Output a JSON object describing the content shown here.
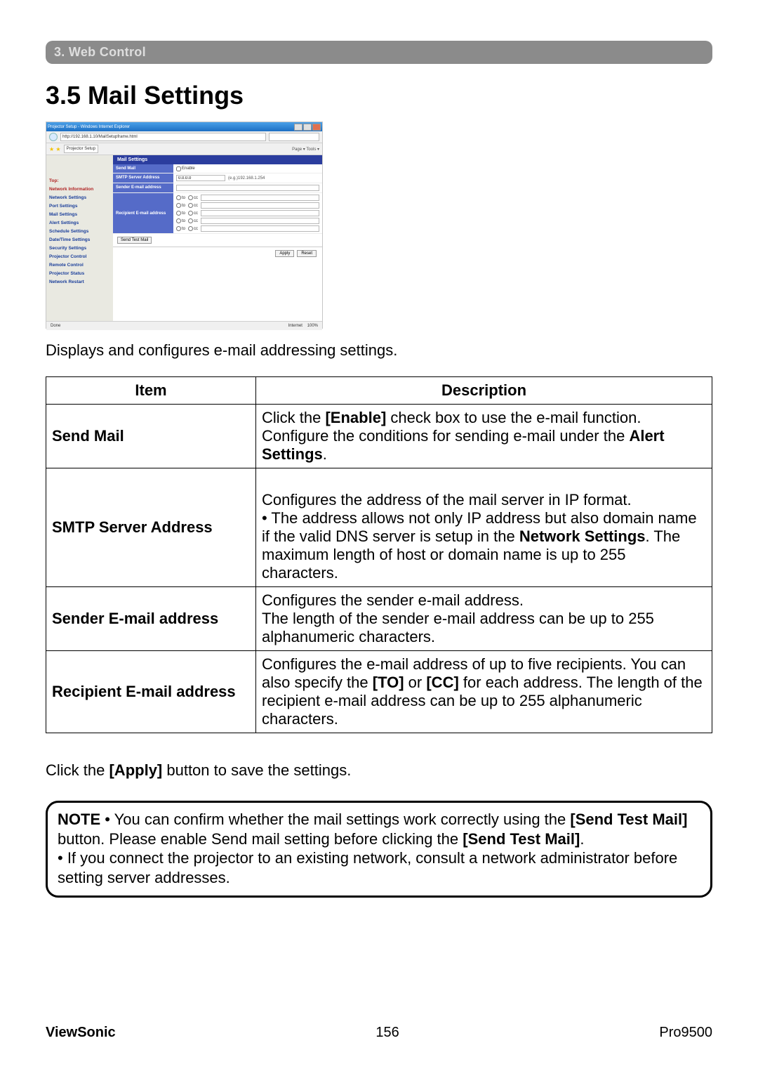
{
  "chapter_bar": "3. Web Control",
  "section_title": "3.5 Mail Settings",
  "lead_text": "Displays and configures e-mail addressing settings.",
  "screenshot": {
    "window_title": "Projector Setup - Windows Internet Explorer",
    "url": "http://192.168.1.10/MailSetupframe.html",
    "tab_label": "Projector Setup",
    "toolbar_txt": "Page ▾  Tools ▾",
    "sidebar": {
      "items": [
        {
          "label": "Top:",
          "active": true
        },
        {
          "label": "Network Information",
          "active": true
        },
        {
          "label": "Network Settings",
          "active": false
        },
        {
          "label": "Port Settings",
          "active": false
        },
        {
          "label": "Mail Settings",
          "active": false
        },
        {
          "label": "Alert Settings",
          "active": false
        },
        {
          "label": "Schedule Settings",
          "active": false
        },
        {
          "label": "Date/Time Settings",
          "active": false
        },
        {
          "label": "Security Settings",
          "active": false
        },
        {
          "label": "Projector Control",
          "active": false
        },
        {
          "label": "Remote Control",
          "active": false
        },
        {
          "label": "Projector Status",
          "active": false
        },
        {
          "label": "Network Restart",
          "active": false
        }
      ]
    },
    "panel": {
      "heading": "Mail Settings",
      "rows": {
        "send_mail": "Send Mail",
        "enable": "Enable",
        "smtp": "SMTP Server Address",
        "smtp_val": "0.0.0.0",
        "smtp_hint": "(e.g.)192.168.1.254",
        "sender": "Sender E-mail address",
        "recipient": "Recipient E-mail address",
        "to": "to",
        "cc": "cc",
        "send_test": "Send Test Mail",
        "apply": "Apply",
        "reset": "Reset"
      }
    },
    "status": {
      "left": "Done",
      "mid": "Internet",
      "right": "100%"
    }
  },
  "table": {
    "headers": {
      "item": "Item",
      "desc": "Description"
    },
    "rows": [
      {
        "item": "Send Mail",
        "desc_pre": "Click the ",
        "desc_b1": "[Enable]",
        "desc_mid1": " check box to use the e-mail function. Configure the conditions for sending e-mail under the ",
        "desc_b2": "Alert Settings",
        "desc_post": "."
      },
      {
        "item": "SMTP Server Address",
        "desc_pre": "Configures the address of the mail server in IP format.\n• The address allows not only IP address but also domain name if the valid DNS server is setup in the ",
        "desc_b1": "Network Settings",
        "desc_post": ". The maximum length of host or domain name is up to 255 characters."
      },
      {
        "item": "Sender E-mail address",
        "desc_pre": "Configures the sender e-mail address.\nThe length of the sender e-mail address can be up to 255 alphanumeric characters."
      },
      {
        "item": "Recipient E-mail address",
        "desc_pre": "Configures the e-mail address of up to five recipients. You can also specify the ",
        "desc_b1": "[TO]",
        "desc_mid1": " or ",
        "desc_b2": "[CC]",
        "desc_post": " for each address. The length of the recipient e-mail address can be up to 255 alphanumeric characters."
      }
    ]
  },
  "after_table_pre": "Click the ",
  "after_table_b": "[Apply]",
  "after_table_post": " button to save the settings.",
  "note": {
    "label": "NOTE",
    "l1a": " • You can confirm whether the mail settings work correctly using the ",
    "l1b": "[Send Test Mail]",
    "l1c": " button. Please enable Send mail setting before clicking the ",
    "l1d": "[Send Test Mail]",
    "l1e": ".",
    "l2": "• If you connect the projector to an existing network, consult a network administrator before setting server addresses."
  },
  "footer": {
    "brand": "ViewSonic",
    "page": "156",
    "model": "Pro9500"
  }
}
